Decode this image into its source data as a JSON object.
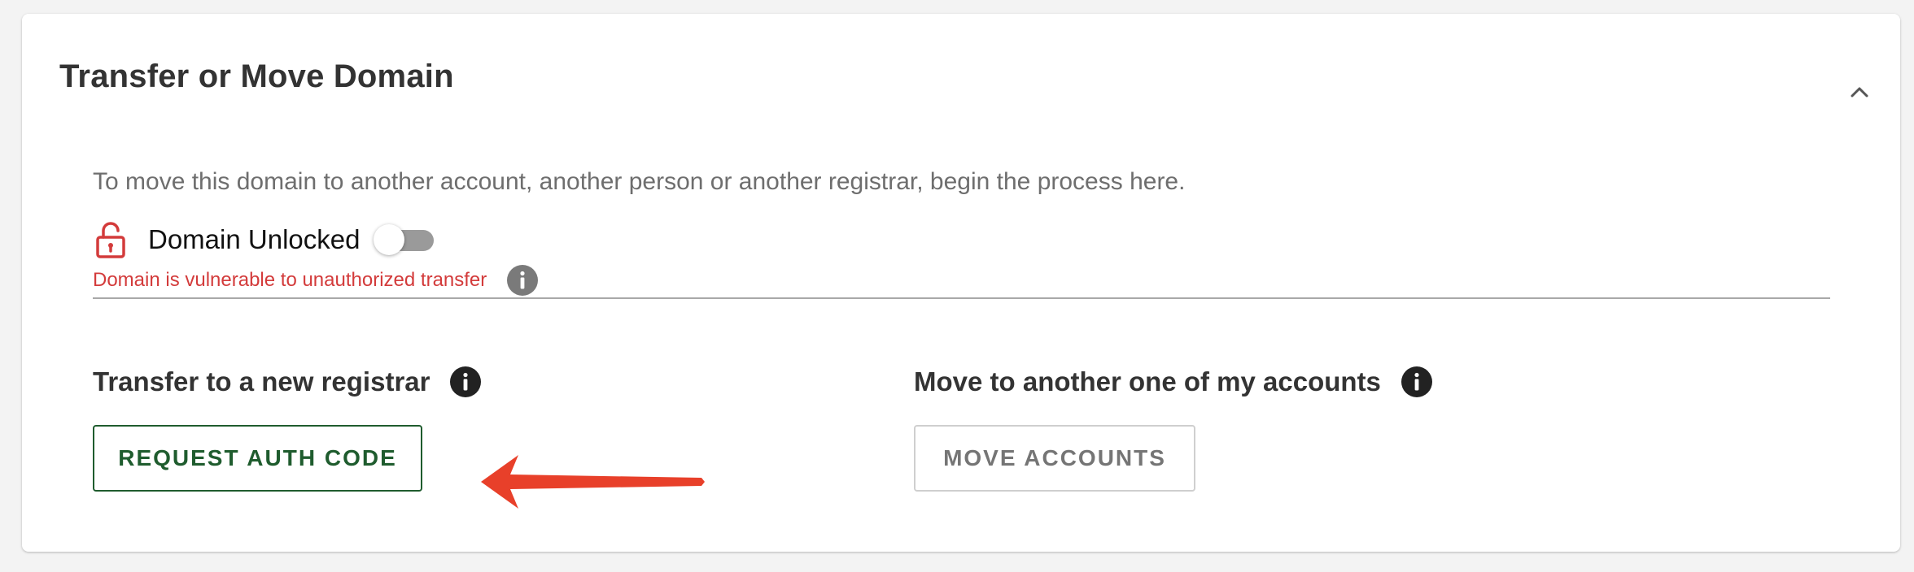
{
  "panel": {
    "title": "Transfer or Move Domain",
    "collapse_icon": "chevron-up-icon"
  },
  "description": "To move this domain to another account, another person or another registrar, begin the process here.",
  "lock_status": {
    "icon": "unlocked-padlock-icon",
    "label": "Domain Unlocked",
    "toggle_on": false,
    "warning": "Domain is vulnerable to unauthorized transfer",
    "warning_color": "#d33b3b"
  },
  "transfer": {
    "title": "Transfer to a new registrar",
    "button_label": "REQUEST AUTH CODE",
    "button_color": "#1f5c2e"
  },
  "move": {
    "title": "Move to another one of my accounts",
    "button_label": "MOVE ACCOUNTS"
  },
  "annotation": {
    "arrow_color": "#e8402a"
  }
}
